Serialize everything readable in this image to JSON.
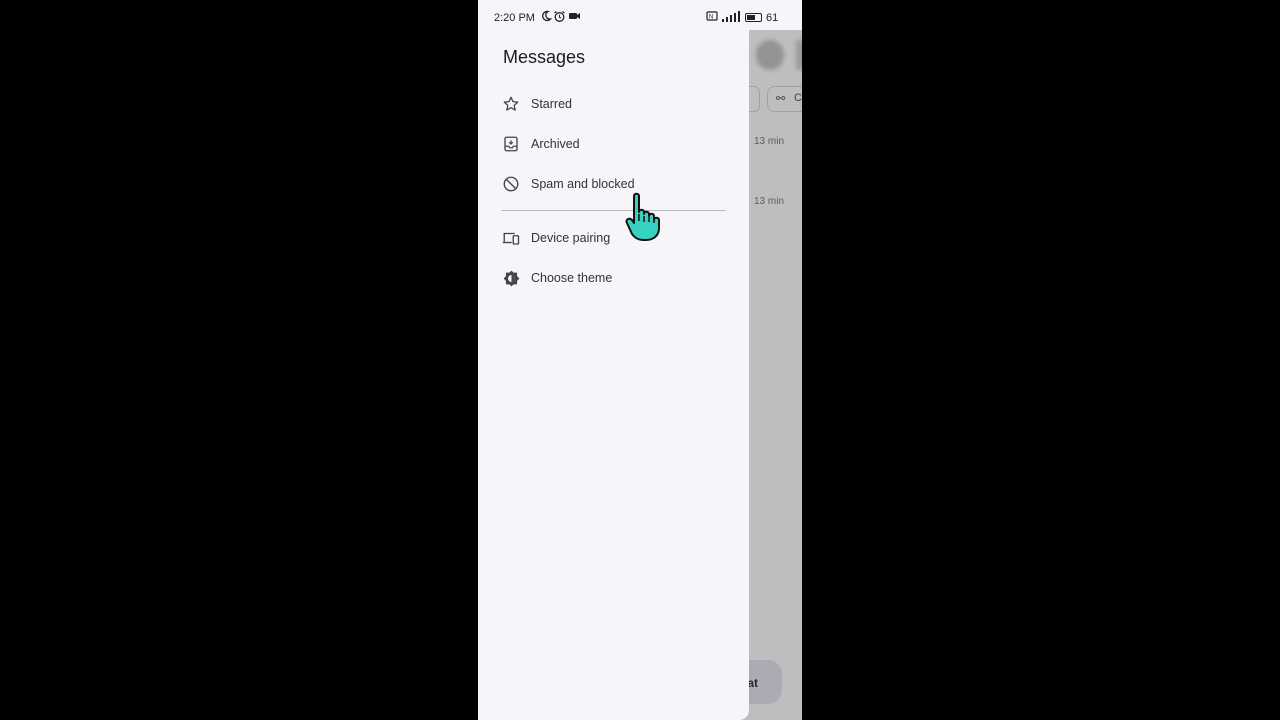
{
  "status_bar": {
    "time": "2:20 PM",
    "battery_percent": "61",
    "icons": [
      "moon-icon",
      "alarm-icon",
      "video-icon",
      "sim-icon",
      "signal-icon",
      "battery-icon"
    ]
  },
  "drawer": {
    "title": "Messages",
    "items": [
      {
        "label": "Starred",
        "icon": "star-icon"
      },
      {
        "label": "Archived",
        "icon": "archive-icon"
      },
      {
        "label": "Spam and blocked",
        "icon": "block-icon"
      },
      {
        "label": "Device pairing",
        "icon": "devices-icon"
      },
      {
        "label": "Choose theme",
        "icon": "theme-icon"
      }
    ]
  },
  "background": {
    "chip_label": "C",
    "times": [
      "13 min",
      "13 min"
    ],
    "fab_label": "hat"
  },
  "colors": {
    "drawer_bg": "#f6f5f9",
    "cursor": "#37d1c4"
  }
}
